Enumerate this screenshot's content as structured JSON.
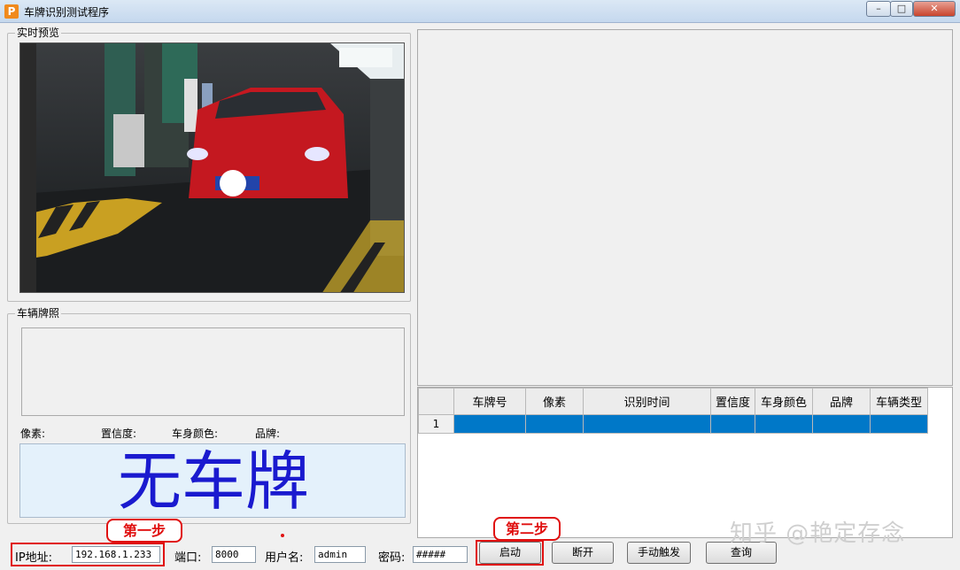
{
  "window": {
    "app_icon": "P",
    "title": "车牌识别测试程序",
    "minimize_label": "–",
    "maximize_label": "□",
    "close_label": "✕"
  },
  "preview_group": {
    "legend": "实时预览"
  },
  "plate_group": {
    "legend": "车辆牌照",
    "pixel_label": "像素:",
    "confidence_label": "置信度:",
    "color_label": "车身颜色:",
    "brand_label": "品牌:",
    "no_plate_text": "无车牌"
  },
  "results_table": {
    "columns": [
      "",
      "车牌号",
      "像素",
      "识别时间",
      "置信度",
      "车身颜色",
      "品牌",
      "车辆类型"
    ],
    "rows": [
      {
        "index": "1",
        "cells": [
          "",
          "",
          "",
          "",
          "",
          "",
          ""
        ]
      }
    ]
  },
  "connection": {
    "ip_label": "IP地址:",
    "ip_value": "192.168.1.233",
    "port_label": "端口:",
    "port_value": "8000",
    "username_label": "用户名:",
    "username_value": "admin",
    "password_label": "密码:",
    "password_value": "#####"
  },
  "buttons": {
    "start": "启动",
    "disconnect": "断开",
    "manual_trigger": "手动触发",
    "query": "查询"
  },
  "annotations": {
    "step1": "第一步",
    "step2": "第二步",
    "accent_color": "#e01010"
  },
  "watermark": "知乎 @艳定存念",
  "icons": {
    "app": "app-icon",
    "minimize": "minimize-icon",
    "maximize": "maximize-icon",
    "close": "close-icon"
  }
}
